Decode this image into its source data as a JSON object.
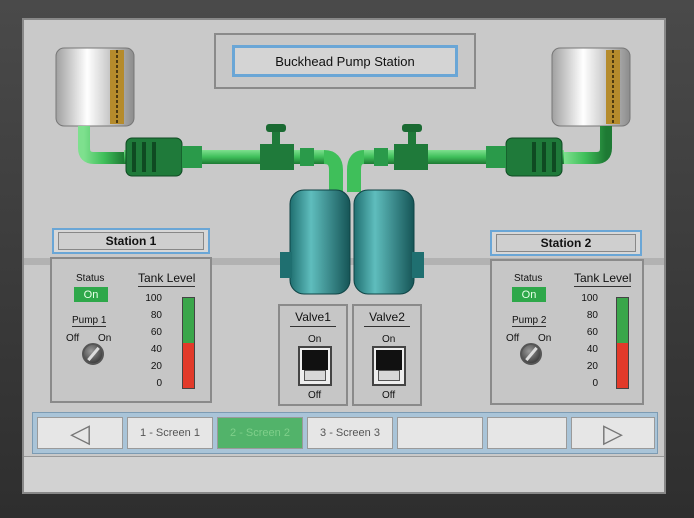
{
  "title": "Buckhead Pump Station",
  "stations": [
    {
      "header": "Station 1",
      "status_label": "Status",
      "status_value": "On",
      "pump_label": "Pump 1",
      "pump_off": "Off",
      "pump_on": "On",
      "tank_label": "Tank Level",
      "tank_level_percent": 50,
      "ticks": [
        "100",
        "80",
        "60",
        "40",
        "20",
        "0"
      ]
    },
    {
      "header": "Station 2",
      "status_label": "Status",
      "status_value": "On",
      "pump_label": "Pump 2",
      "pump_off": "Off",
      "pump_on": "On",
      "tank_label": "Tank Level",
      "tank_level_percent": 50,
      "ticks": [
        "100",
        "80",
        "60",
        "40",
        "20",
        "0"
      ]
    }
  ],
  "valves": [
    {
      "label": "Valve1",
      "on": "On",
      "off": "Off"
    },
    {
      "label": "Valve2",
      "on": "On",
      "off": "Off"
    }
  ],
  "nav": {
    "prev_icon": "left-arrow-icon",
    "next_icon": "right-arrow-icon",
    "screens": [
      "1 - Screen 1",
      "2 - Screen 2",
      "3 - Screen 3"
    ],
    "active_index": 1
  },
  "colors": {
    "pipe": "#3fbf5a",
    "tank": "#2b8a8a",
    "status_on": "#2ea84a",
    "level_fill": "#e23a2a",
    "level_upper": "#3aa64a",
    "accent_border": "#6aa6d6"
  }
}
